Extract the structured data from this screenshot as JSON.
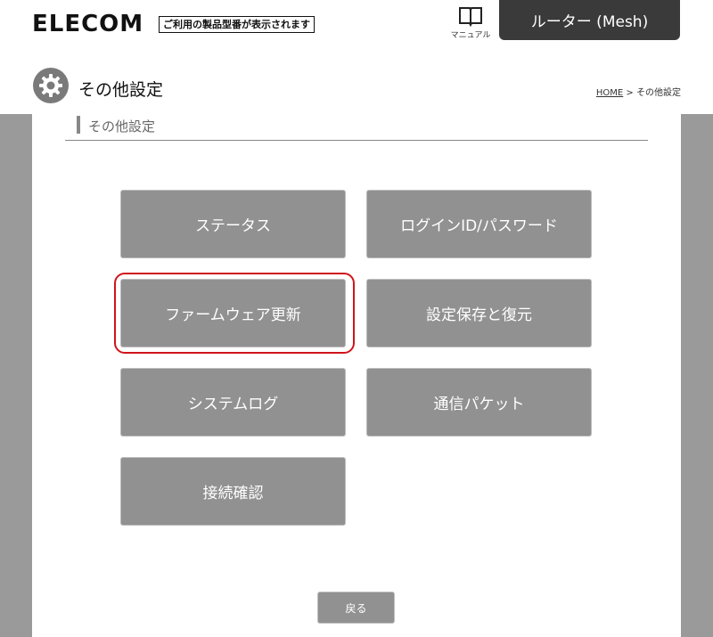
{
  "header": {
    "logo": "ELECOM",
    "tagline": "ご利用の製品型番が表示されます",
    "manual_label": "マニュアル",
    "router_tab": "ルーター (Mesh)"
  },
  "page": {
    "title": "その他設定",
    "breadcrumb_home": "HOME",
    "breadcrumb_sep": " > ",
    "breadcrumb_current": "その他設定",
    "section_heading": "その他設定"
  },
  "menu": {
    "status": "ステータス",
    "login_password": "ログインID/パスワード",
    "firmware_update": "ファームウェア更新",
    "settings_save_restore": "設定保存と復元",
    "system_log": "システムログ",
    "packets": "通信パケット",
    "connection_check": "接続確認"
  },
  "footer": {
    "back": "戻る"
  },
  "colors": {
    "button_gray": "#919191",
    "side_gray": "#9a9a9a",
    "highlight_red": "#d0141c",
    "tab_dark": "#3a3a3a"
  }
}
